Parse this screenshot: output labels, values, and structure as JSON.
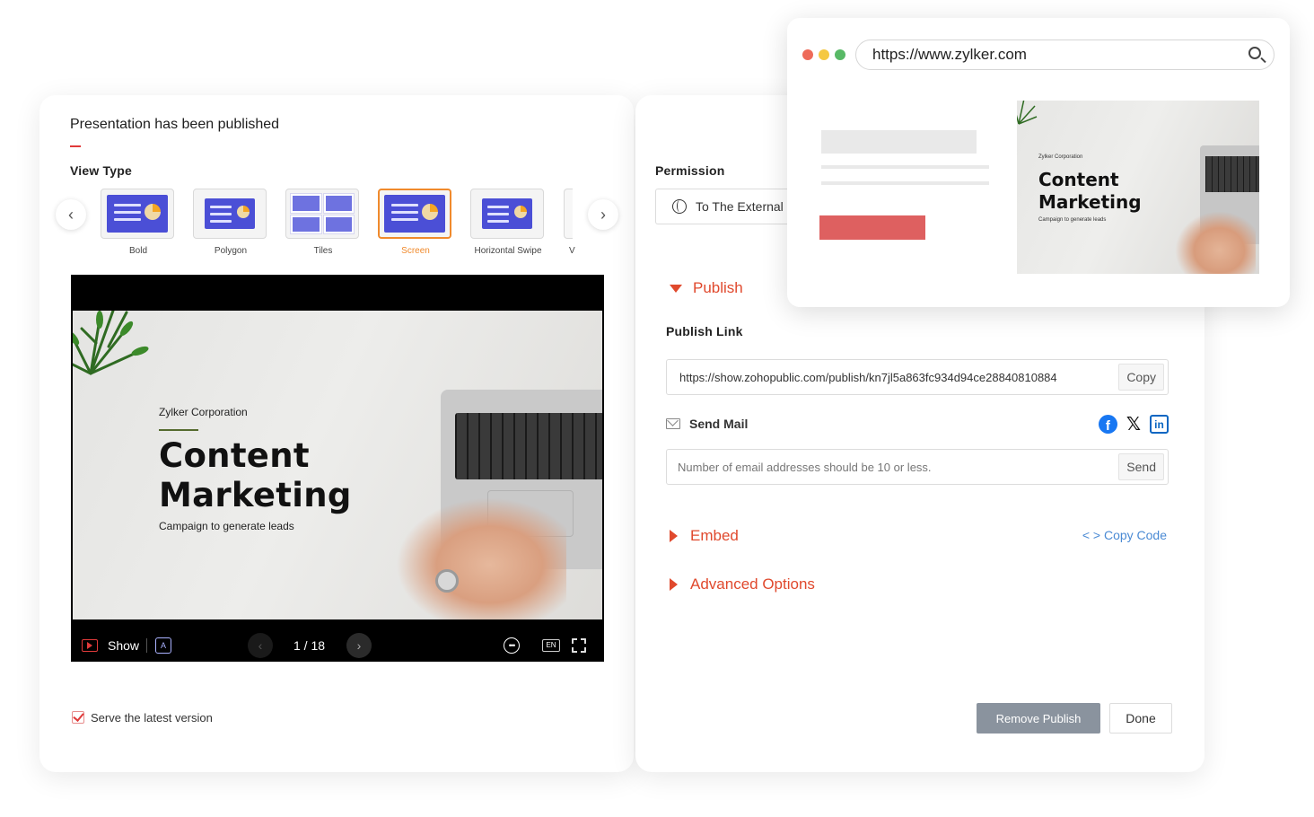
{
  "dialog": {
    "title": "Presentation has been published",
    "view_type_label": "View Type",
    "view_types": [
      {
        "label": "Bold",
        "active": false
      },
      {
        "label": "Polygon",
        "active": false
      },
      {
        "label": "Tiles",
        "active": false
      },
      {
        "label": "Screen",
        "active": true
      },
      {
        "label": "Horizontal Swipe",
        "active": false
      },
      {
        "label": "V",
        "active": false
      }
    ],
    "serve_latest_label": "Serve the latest version",
    "serve_latest_checked": true
  },
  "slide": {
    "corporation": "Zylker Corporation",
    "heading_line1": "Content",
    "heading_line2": "Marketing",
    "subtitle": "Campaign to generate leads"
  },
  "player": {
    "show_label": "Show",
    "current_page": 1,
    "page_display": "1 / 18",
    "total_pages": 18
  },
  "permission": {
    "label": "Permission",
    "value": "To The External"
  },
  "publish": {
    "section_label": "Publish",
    "link_label": "Publish Link",
    "link_value": "https://show.zohopublic.com/publish/kn7jl5a863fc934d94ce28840810884",
    "copy_label": "Copy",
    "send_mail_label": "Send Mail",
    "email_placeholder": "Number of email addresses should be 10 or less.",
    "send_label": "Send"
  },
  "embed": {
    "label": "Embed",
    "copy_code_label": "< >  Copy Code"
  },
  "advanced": {
    "label": "Advanced Options"
  },
  "buttons": {
    "remove_publish": "Remove Publish",
    "done": "Done"
  },
  "browser": {
    "url": "https://www.zylker.com",
    "dot_colors": [
      "#ee6b5a",
      "#f5c842",
      "#58b966"
    ]
  },
  "colors": {
    "accent": "#e0492d",
    "active_view": "#f08a2c",
    "link_blue": "#4a8ad4"
  }
}
